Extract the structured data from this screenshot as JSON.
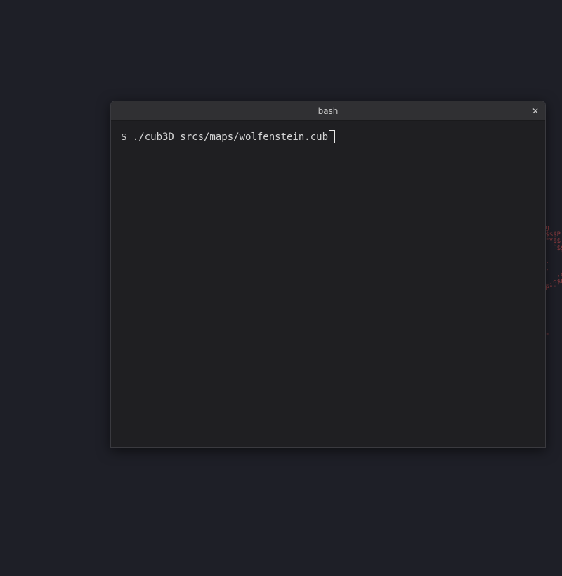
{
  "window": {
    "title": "bash",
    "close_glyph": "✕"
  },
  "terminal": {
    "prompt": "$ ",
    "command": "./cub3D srcs/maps/wolfenstein.cub"
  },
  "wallpaper": {
    "art_color": "#8b3b3f",
    "ascii_art": "         _,met$$$$$gg.\n      ,g$$$$$$$$$$$$$$$P.\n    ,g$$P\"\"       \"\"\"Y$$.\".\n   ,$$P'              `$$$.\n  ',$$P       ,ggs.     `$$b:\n  `d$$'     ,$P\"'   .    $$$\n   $$P      d$'     ,    $$P\n   $$:      $$.   -    ,d$$'\n   $$;      Y$b._   _,d$P'\n   Y$$.    `.`\"Y$$$$P\"'\n   `$$b      \"-.__\n    `Y$$\n     `Y$$.\n       `$$b.\n         `Y$$b.\n            `\"Y$b._\n                `\"\"\"\""
  },
  "colors": {
    "desktop_bg": "#1e1f27",
    "terminal_bg": "#1f1f22",
    "titlebar_bg": "#303033",
    "text": "#d6d6d6"
  }
}
